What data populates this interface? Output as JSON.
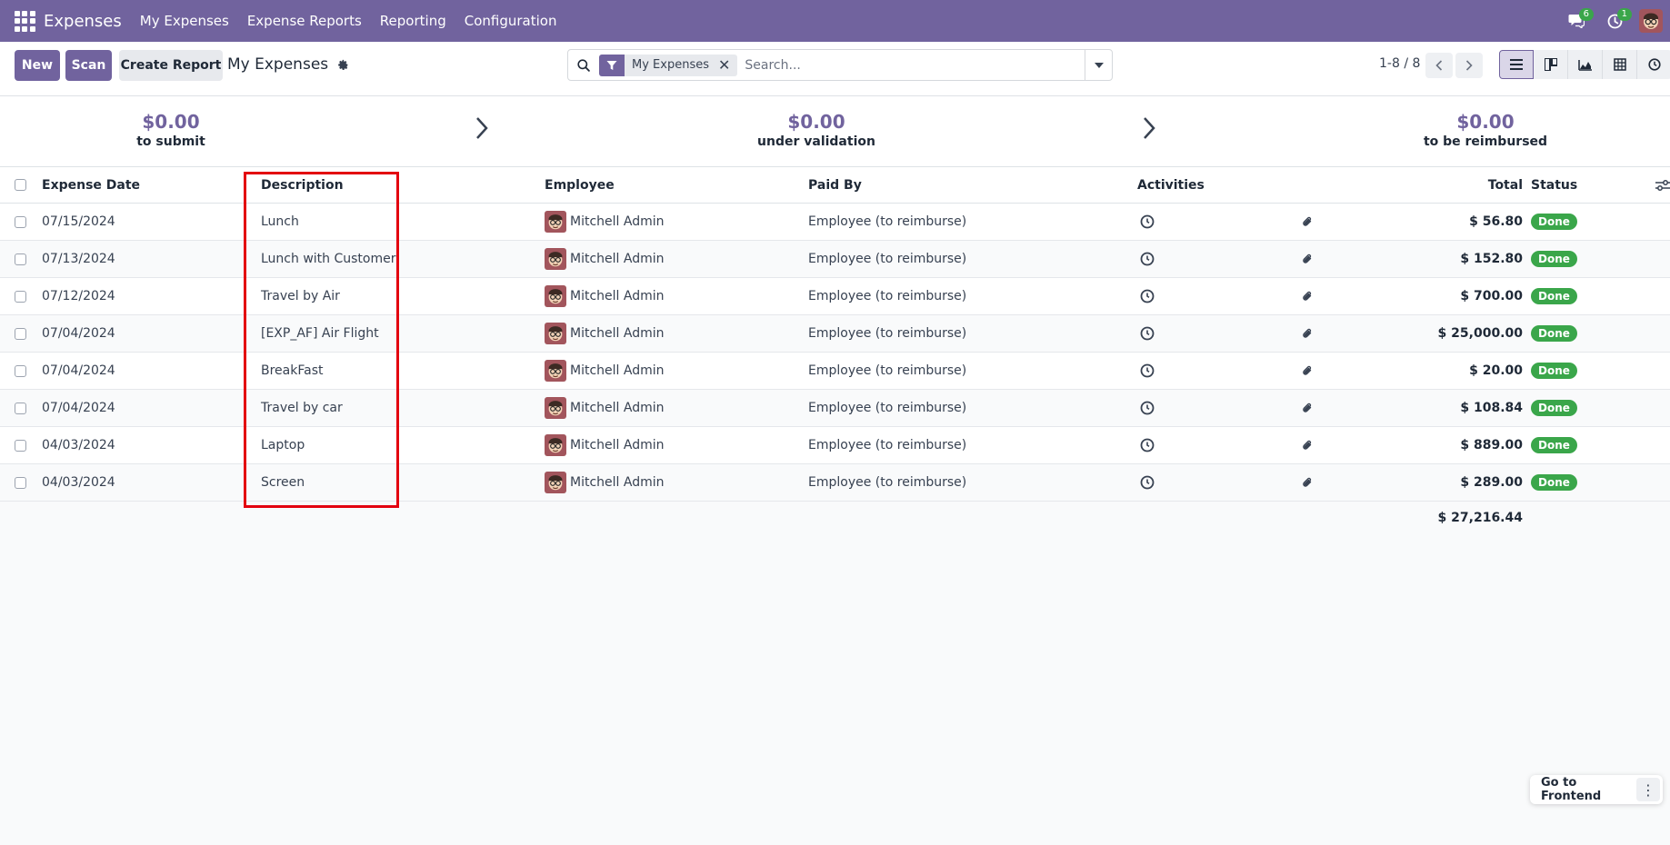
{
  "navbar": {
    "brand": "Expenses",
    "menu": [
      "My Expenses",
      "Expense Reports",
      "Reporting",
      "Configuration"
    ],
    "messages_count": "6",
    "activities_count": "1",
    "icons": [
      "apps-grid-icon",
      "chat-icon",
      "clock-icon",
      "user-avatar"
    ]
  },
  "control": {
    "new_label": "New",
    "scan_label": "Scan",
    "create_report_label": "Create Report",
    "breadcrumb": "My Expenses",
    "facet_label": "My Expenses",
    "search_placeholder": "Search...",
    "pager": "1-8 / 8"
  },
  "summary": [
    {
      "amount": "$0.00",
      "label": "to submit"
    },
    {
      "amount": "$0.00",
      "label": "under validation"
    },
    {
      "amount": "$0.00",
      "label": "to be reimbursed"
    }
  ],
  "table": {
    "headers": [
      "Expense Date",
      "Description",
      "Employee",
      "Paid By",
      "Activities",
      "Total",
      "Status"
    ],
    "rows": [
      {
        "date": "07/15/2024",
        "description": "Lunch",
        "employee": "Mitchell Admin",
        "paid_by": "Employee (to reimburse)",
        "total": "$ 56.80",
        "status": "Done"
      },
      {
        "date": "07/13/2024",
        "description": "Lunch with Customer",
        "employee": "Mitchell Admin",
        "paid_by": "Employee (to reimburse)",
        "total": "$ 152.80",
        "status": "Done"
      },
      {
        "date": "07/12/2024",
        "description": "Travel by Air",
        "employee": "Mitchell Admin",
        "paid_by": "Employee (to reimburse)",
        "total": "$ 700.00",
        "status": "Done"
      },
      {
        "date": "07/04/2024",
        "description": "[EXP_AF] Air Flight",
        "employee": "Mitchell Admin",
        "paid_by": "Employee (to reimburse)",
        "total": "$ 25,000.00",
        "status": "Done"
      },
      {
        "date": "07/04/2024",
        "description": "BreakFast",
        "employee": "Mitchell Admin",
        "paid_by": "Employee (to reimburse)",
        "total": "$ 20.00",
        "status": "Done"
      },
      {
        "date": "07/04/2024",
        "description": "Travel by car",
        "employee": "Mitchell Admin",
        "paid_by": "Employee (to reimburse)",
        "total": "$ 108.84",
        "status": "Done"
      },
      {
        "date": "04/03/2024",
        "description": "Laptop",
        "employee": "Mitchell Admin",
        "paid_by": "Employee (to reimburse)",
        "total": "$ 889.00",
        "status": "Done"
      },
      {
        "date": "04/03/2024",
        "description": "Screen",
        "employee": "Mitchell Admin",
        "paid_by": "Employee (to reimburse)",
        "total": "$ 289.00",
        "status": "Done"
      }
    ],
    "grand_total": "$ 27,216.44"
  },
  "floating": {
    "go_frontend": "Go to Frontend"
  },
  "colors": {
    "brand": "#71639e",
    "status_done": "#3aa64a",
    "highlight": "#e3000f"
  }
}
